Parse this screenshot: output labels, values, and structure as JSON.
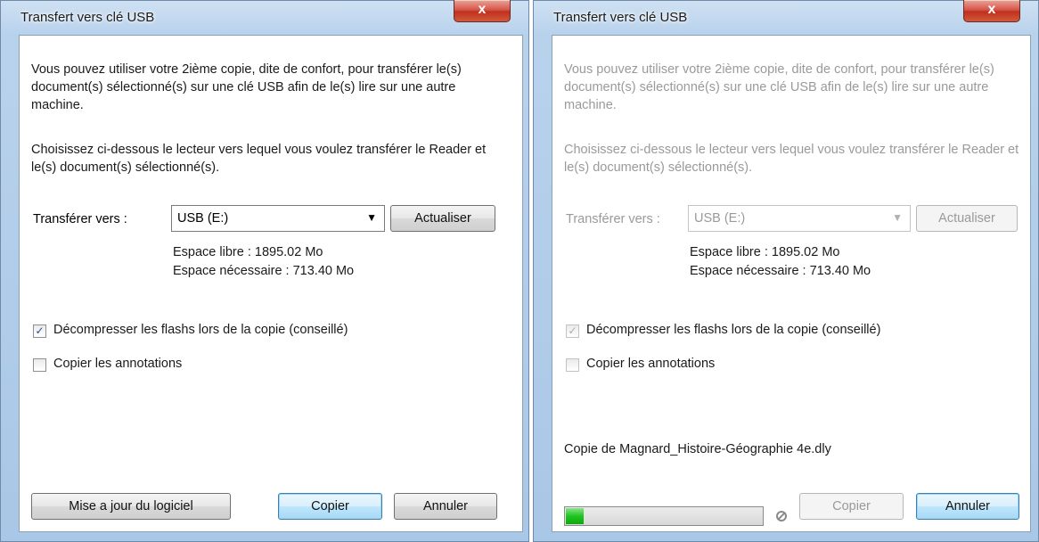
{
  "colors": {
    "frame_blue": "#a9c7e6",
    "close_red": "#c1301f",
    "progress_green": "#1fc51f",
    "default_button_blue": "#3c7fb1"
  },
  "left": {
    "title": "Transfert vers clé USB",
    "close_label": "x",
    "paragraph1": "Vous pouvez utiliser votre 2ième copie, dite de confort, pour transférer le(s) document(s) sélectionné(s) sur une clé USB afin de le(s) lire sur une autre machine.",
    "paragraph2": "Choisissez ci-dessous le lecteur vers lequel vous voulez transférer le Reader et le(s) document(s) sélectionné(s).",
    "transfer_label": "Transférer vers :",
    "drive_value": "USB (E:)",
    "refresh_label": "Actualiser",
    "free_space": "Espace libre : 1895.02 Mo",
    "required_space": "Espace nécessaire : 713.40 Mo",
    "checkbox1_label": "Décompresser les flashs lors de la copie (conseillé)",
    "checkbox1_checked": true,
    "checkbox2_label": "Copier les annotations",
    "checkbox2_checked": false,
    "update_label": "Mise a jour du logiciel",
    "copy_label": "Copier",
    "cancel_label": "Annuler"
  },
  "right": {
    "title": "Transfert vers clé USB",
    "close_label": "x",
    "paragraph1": "Vous pouvez utiliser votre 2ième copie, dite de confort, pour transférer le(s) document(s) sélectionné(s) sur une clé USB afin de le(s) lire sur une autre machine.",
    "paragraph2": "Choisissez ci-dessous le lecteur vers lequel vous voulez transférer le Reader et le(s) document(s) sélectionné(s).",
    "transfer_label": "Transférer vers :",
    "drive_value": "USB (E:)",
    "refresh_label": "Actualiser",
    "free_space": "Espace libre : 1895.02 Mo",
    "required_space": "Espace nécessaire : 713.40 Mo",
    "checkbox1_label": "Décompresser les flashs lors de la copie (conseillé)",
    "checkbox1_checked": true,
    "checkbox2_label": "Copier les annotations",
    "checkbox2_checked": false,
    "progress_text": "Copie de Magnard_Histoire-Géographie 4e.dly",
    "progress_percent": 10,
    "copy_label": "Copier",
    "cancel_label": "Annuler"
  }
}
